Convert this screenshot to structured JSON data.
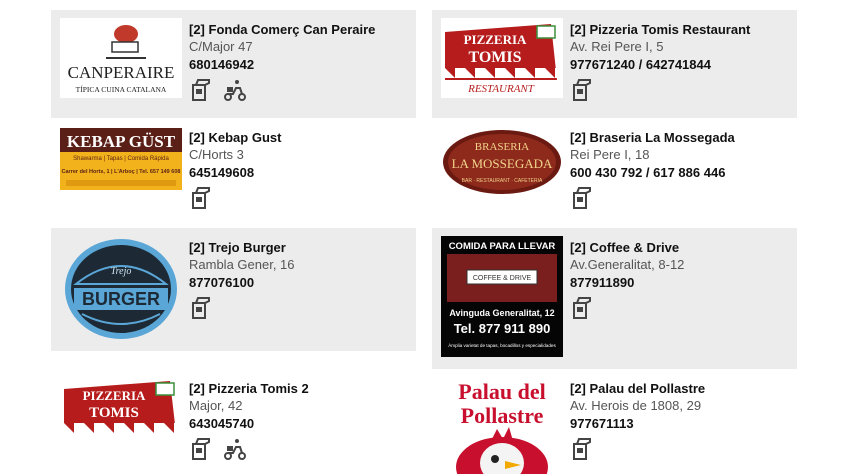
{
  "colors": {
    "card_bg": "#ececec",
    "accent_red": "#c8102e",
    "text": "#111111"
  },
  "restaurants": [
    {
      "name": "[2] Fonda Comerç Can Peraire",
      "address": "C/Major 47",
      "phone": "680146942",
      "logo": {
        "line1": "CANPERAIRE",
        "line2": "TÍPICA CUINA CATALANA"
      }
    },
    {
      "name": "[2] Pizzeria Tomis Restaurant",
      "address": "Av. Rei Pere I, 5",
      "phone": "977671240 / 642741844",
      "logo": {
        "line1": "PIZZERIA",
        "line2": "TOMIS",
        "line3": "RESTAURANT"
      }
    },
    {
      "name": "[2] Kebap Gust",
      "address": "C/Horts 3",
      "phone": "645149608",
      "logo": {
        "line1": "KEBAP GÜST",
        "line2": "Shawarma | Tapas | Comida Rápida",
        "line3": "Carrer del Horts, 1 | L'Arboç | Tel. 657 149 608"
      }
    },
    {
      "name": "[2] Braseria La Mossegada",
      "address": "Rei Pere I, 18",
      "phone": "600 430 792 / 617 886 446",
      "logo": {
        "line1": "BRASERIA",
        "line2": "LA MOSSEGADA",
        "line3": "BAR · RESTAURANT · CAFETERIA"
      }
    },
    {
      "name": "[2] Trejo Burger",
      "address": "Rambla Gener, 16",
      "phone": "877076100",
      "logo": {
        "line1": "Trejo",
        "line2": "BURGER"
      }
    },
    {
      "name": "[2] Coffee & Drive",
      "address": "Av.Generalitat, 8-12",
      "phone": "877911890",
      "logo": {
        "line1": "COMIDA PARA LLEVAR",
        "line2": "COFFEE & DRIVE",
        "line3": "Avinguda Generalitat, 12",
        "line4": "Tel. 877 911 890",
        "line5": "Àmplia varietat de tapas, bocadillos y especialidades"
      }
    },
    {
      "name": "[2] Pizzeria Tomis 2",
      "address": "Major, 42",
      "phone": "643045740",
      "logo": {
        "line1": "PIZZERIA",
        "line2": "TOMIS"
      }
    },
    {
      "name": "[2] Palau del Pollastre",
      "address": "Av. Herois de 1808, 29",
      "phone": "977671113",
      "logo": {
        "line1": "Palau del",
        "line2": "Pollastre"
      }
    }
  ]
}
